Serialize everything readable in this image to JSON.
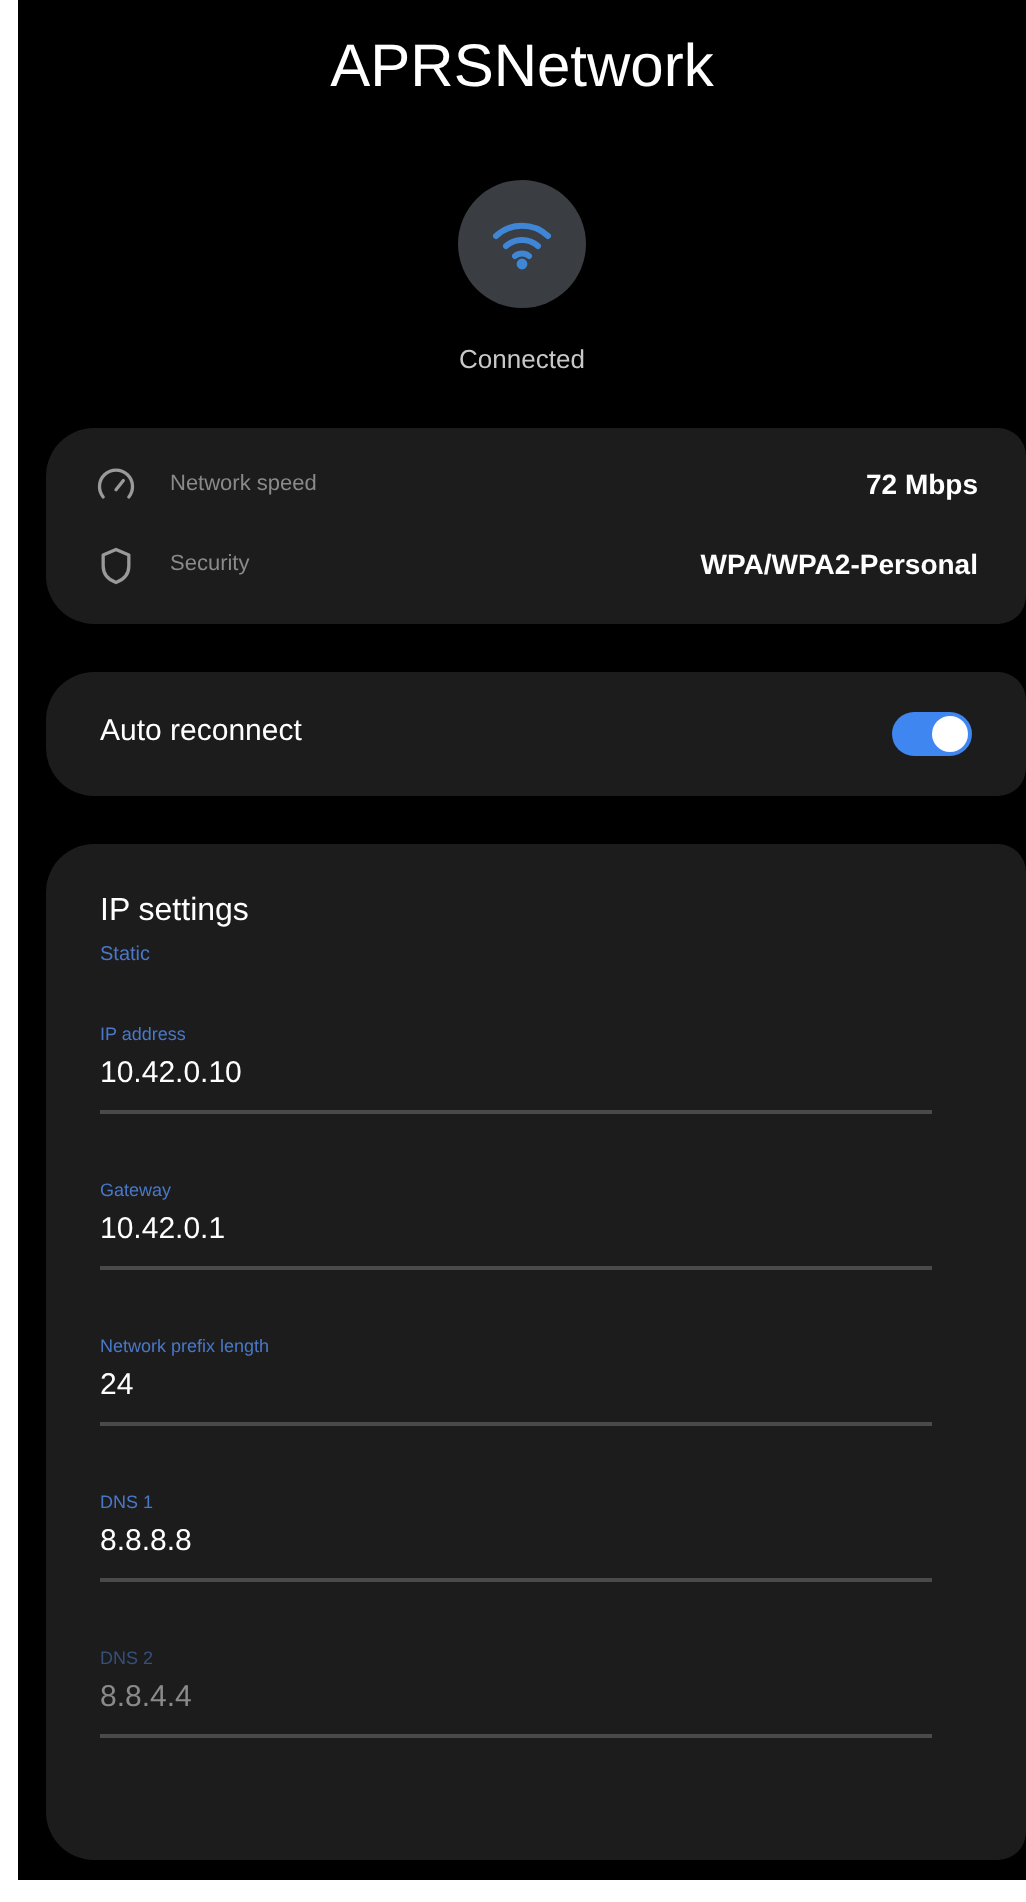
{
  "title": "APRSNetwork",
  "status": "Connected",
  "details": [
    {
      "kind": "speed",
      "label": "Network speed",
      "value": "72 Mbps"
    },
    {
      "kind": "security",
      "label": "Security",
      "value": "WPA/WPA2-Personal"
    }
  ],
  "auto_reconnect": {
    "label": "Auto reconnect",
    "on": true
  },
  "ip_settings": {
    "title": "IP settings",
    "mode": "Static",
    "fields": [
      {
        "label": "IP address",
        "value": "10.42.0.10"
      },
      {
        "label": "Gateway",
        "value": "10.42.0.1"
      },
      {
        "label": "Network prefix length",
        "value": "24"
      },
      {
        "label": "DNS 1",
        "value": "8.8.8.8"
      },
      {
        "label": "DNS 2",
        "placeholder": "8.8.4.4"
      }
    ]
  }
}
